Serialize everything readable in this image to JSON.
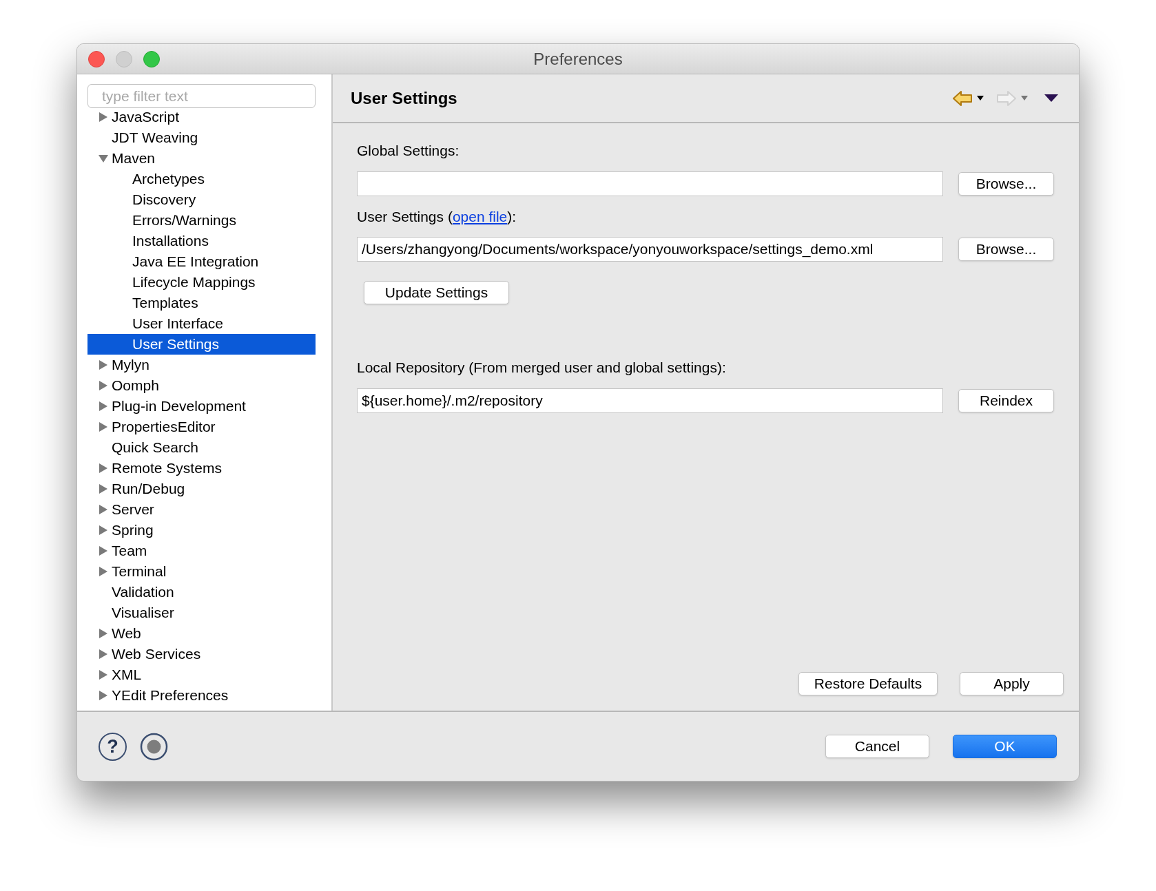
{
  "window": {
    "title": "Preferences"
  },
  "sidebar": {
    "filter": {
      "placeholder": "type filter text"
    },
    "items": [
      {
        "label": "JavaScript",
        "expanded": false,
        "selected": false
      },
      {
        "label": "JDT Weaving",
        "selected": false
      },
      {
        "label": "Maven",
        "expanded": true,
        "selected": false,
        "children": [
          {
            "label": "Archetypes",
            "selected": false
          },
          {
            "label": "Discovery",
            "selected": false
          },
          {
            "label": "Errors/Warnings",
            "selected": false
          },
          {
            "label": "Installations",
            "selected": false
          },
          {
            "label": "Java EE Integration",
            "selected": false
          },
          {
            "label": "Lifecycle Mappings",
            "selected": false
          },
          {
            "label": "Templates",
            "selected": false
          },
          {
            "label": "User Interface",
            "selected": false
          },
          {
            "label": "User Settings",
            "selected": true
          }
        ]
      },
      {
        "label": "Mylyn",
        "expanded": false,
        "selected": false
      },
      {
        "label": "Oomph",
        "expanded": false,
        "selected": false
      },
      {
        "label": "Plug-in Development",
        "expanded": false,
        "selected": false
      },
      {
        "label": "PropertiesEditor",
        "expanded": false,
        "selected": false
      },
      {
        "label": "Quick Search",
        "selected": false
      },
      {
        "label": "Remote Systems",
        "expanded": false,
        "selected": false
      },
      {
        "label": "Run/Debug",
        "expanded": false,
        "selected": false
      },
      {
        "label": "Server",
        "expanded": false,
        "selected": false
      },
      {
        "label": "Spring",
        "expanded": false,
        "selected": false
      },
      {
        "label": "Team",
        "expanded": false,
        "selected": false
      },
      {
        "label": "Terminal",
        "expanded": false,
        "selected": false
      },
      {
        "label": "Validation",
        "selected": false
      },
      {
        "label": "Visualiser",
        "selected": false
      },
      {
        "label": "Web",
        "expanded": false,
        "selected": false
      },
      {
        "label": "Web Services",
        "expanded": false,
        "selected": false
      },
      {
        "label": "XML",
        "expanded": false,
        "selected": false
      },
      {
        "label": "YEdit Preferences",
        "expanded": false,
        "selected": false
      }
    ]
  },
  "page": {
    "title": "User Settings",
    "global_settings": {
      "label": "Global Settings:",
      "button": "Browse..."
    },
    "user_settings": {
      "label_before": "User Settings (",
      "link": "open file",
      "label_after": "):",
      "value": "/Users/zhangyong/Documents/workspace/yonyouworkspace/settings_demo.xml",
      "button": "Browse..."
    },
    "update_button": "Update Settings",
    "local_repository": {
      "label": "Local Repository (From merged user and global settings):",
      "value": "${user.home}/.m2/repository",
      "button": "Reindex"
    },
    "buttons": [
      "Restore Defaults",
      "Apply"
    ]
  },
  "footer": {
    "help_icon": "?",
    "buttons": [
      {
        "label": "Cancel",
        "kind": "normal"
      },
      {
        "label": "OK",
        "kind": "default"
      }
    ]
  }
}
